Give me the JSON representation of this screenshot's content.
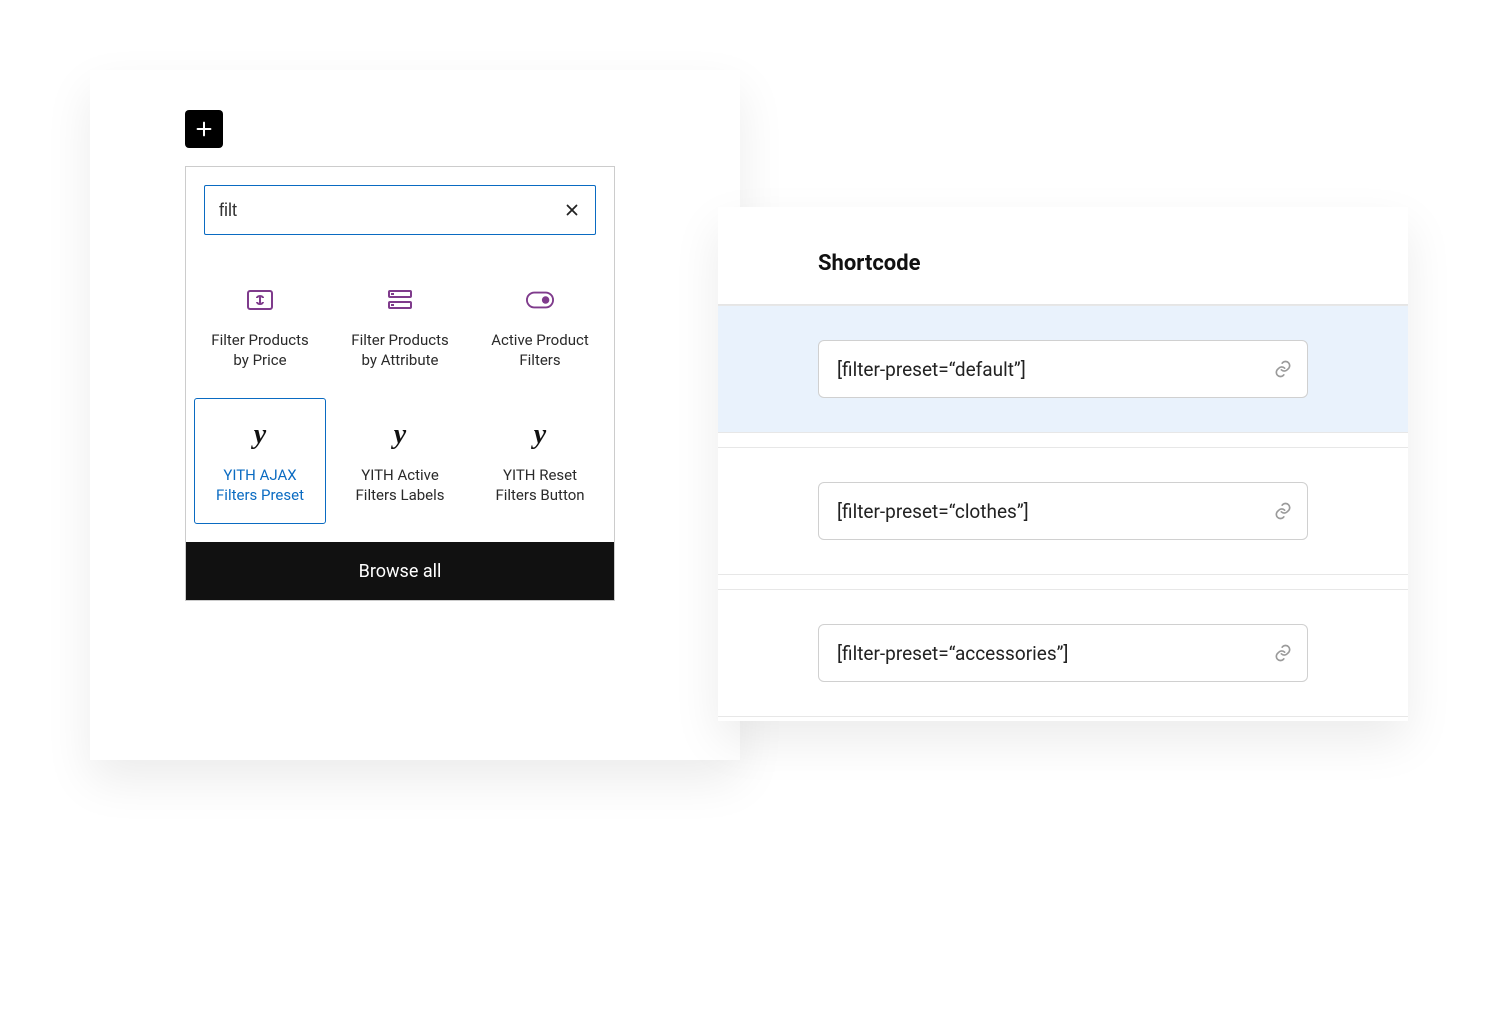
{
  "inserter": {
    "search_value": "filt",
    "blocks": [
      {
        "label": "Filter Products by Price",
        "icon": "price-icon",
        "selected": false
      },
      {
        "label": "Filter Products by Attribute",
        "icon": "attribute-icon",
        "selected": false
      },
      {
        "label": "Active Product Filters",
        "icon": "toggle-icon",
        "selected": false
      },
      {
        "label": "YITH AJAX Filters Preset",
        "icon": "yith-y-icon",
        "selected": true
      },
      {
        "label": "YITH Active Filters Labels",
        "icon": "yith-y-icon",
        "selected": false
      },
      {
        "label": "YITH Reset Filters Button",
        "icon": "yith-y-icon",
        "selected": false
      }
    ],
    "browse_all_label": "Browse all"
  },
  "shortcode_panel": {
    "heading": "Shortcode",
    "rows": [
      {
        "value": "[filter-preset=“default”]",
        "selected": true
      },
      {
        "value": "[filter-preset=“clothes”]",
        "selected": false
      },
      {
        "value": "[filter-preset=“accessories”]",
        "selected": false
      }
    ]
  }
}
